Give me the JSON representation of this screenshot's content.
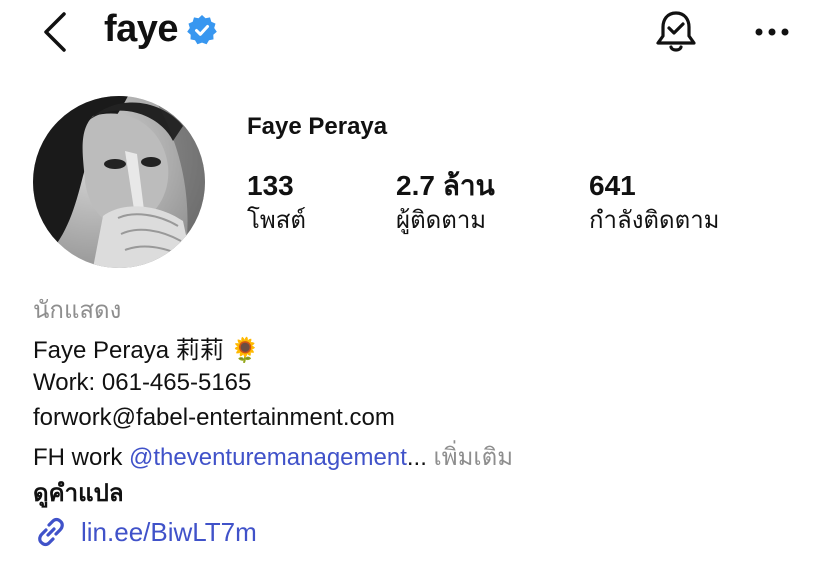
{
  "header": {
    "username": "faye",
    "verified_icon": "verified-badge-icon",
    "accent_color": "#3897f0"
  },
  "profile": {
    "full_name": "Faye Peraya",
    "stats": [
      {
        "value": "133",
        "label": "โพสต์"
      },
      {
        "value": "2.7 ล้าน",
        "label": "ผู้ติดตาม"
      },
      {
        "value": "641",
        "label": "กำลังติดตาม"
      }
    ]
  },
  "bio": {
    "category": "นักแสดง",
    "line1": "Faye Peraya 莉莉 🌻",
    "line2": "Work: 061-465-5165",
    "line3": "forwork@fabel-entertainment.com",
    "line4_prefix": "FH work ",
    "line4_mention": "@theventuremanagement",
    "line4_ellipsis": "...",
    "more_label": " เพิ่มเติม",
    "translate_label": "ดูคำแปล",
    "link_text": "lin.ee/BiwLT7m",
    "link_color": "#4052c9"
  }
}
